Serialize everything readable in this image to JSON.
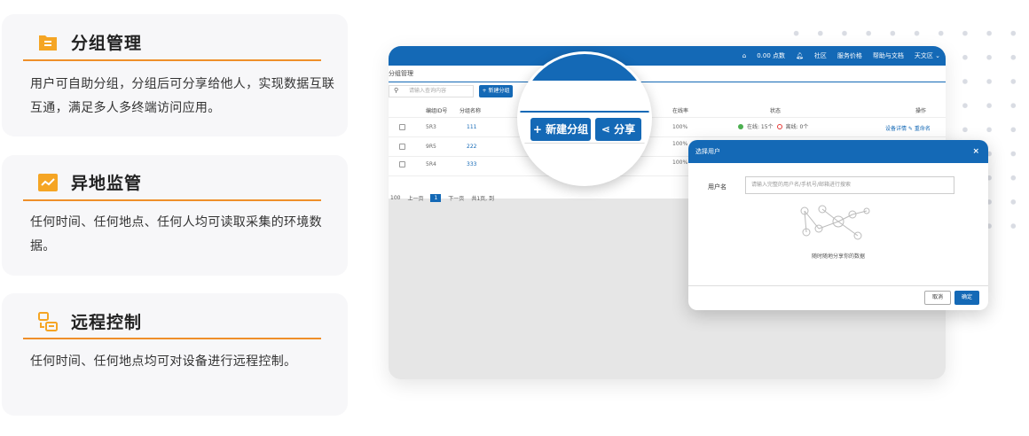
{
  "features": [
    {
      "icon": "group-list-icon",
      "title": "分组管理",
      "desc": "用户可自助分组，分组后可分享给他人，实现数据互联互通，满足多人多终端访问应用。"
    },
    {
      "icon": "chart-line-icon",
      "title": "异地监管",
      "desc": "任何时间、任何地点、任何人均可读取采集的环境数据。"
    },
    {
      "icon": "remote-control-icon",
      "title": "远程控制",
      "desc": "任何时间、任何地点均可对设备进行远程控制。"
    }
  ],
  "colors": {
    "accent": "#ef8f2a",
    "brand_blue": "#1469b6",
    "card_bg": "#f7f7f9"
  },
  "app": {
    "topbar": [
      "0.00 点数",
      "社区",
      "服务价格",
      "帮助与文档",
      "天文区 ⌄"
    ],
    "breadcrumb": "分组管理",
    "search_placeholder": "请输入查询内容",
    "new_group_small": "+ 新建分组",
    "table_headers": [
      "编组ID号",
      "分组名称",
      "在线率",
      "状态",
      "操作"
    ],
    "rows": [
      {
        "id": "5R3",
        "name": "111",
        "rate": "100%"
      },
      {
        "id": "9R5",
        "name": "222",
        "rate": "100%"
      },
      {
        "id": "5R4",
        "name": "333",
        "rate": "100%"
      }
    ],
    "status": {
      "online": "在线: 15个",
      "offline": "离线: 0个"
    },
    "row_actions": "设备详情 ✎ 重命名",
    "pager": {
      "size": "100",
      "prev": "上一页",
      "page": "1",
      "next": "下一页",
      "total": "共1页, 到"
    }
  },
  "magnifier": {
    "new_group": "+ 新建分组",
    "share": "分享"
  },
  "dialog": {
    "title": "选择用户",
    "close": "×",
    "label": "用户名",
    "placeholder": "请输入完整的用户名/手机号/邮箱进行搜索",
    "caption": "随时随地分享你的数据",
    "cancel": "取消",
    "confirm": "确定"
  }
}
